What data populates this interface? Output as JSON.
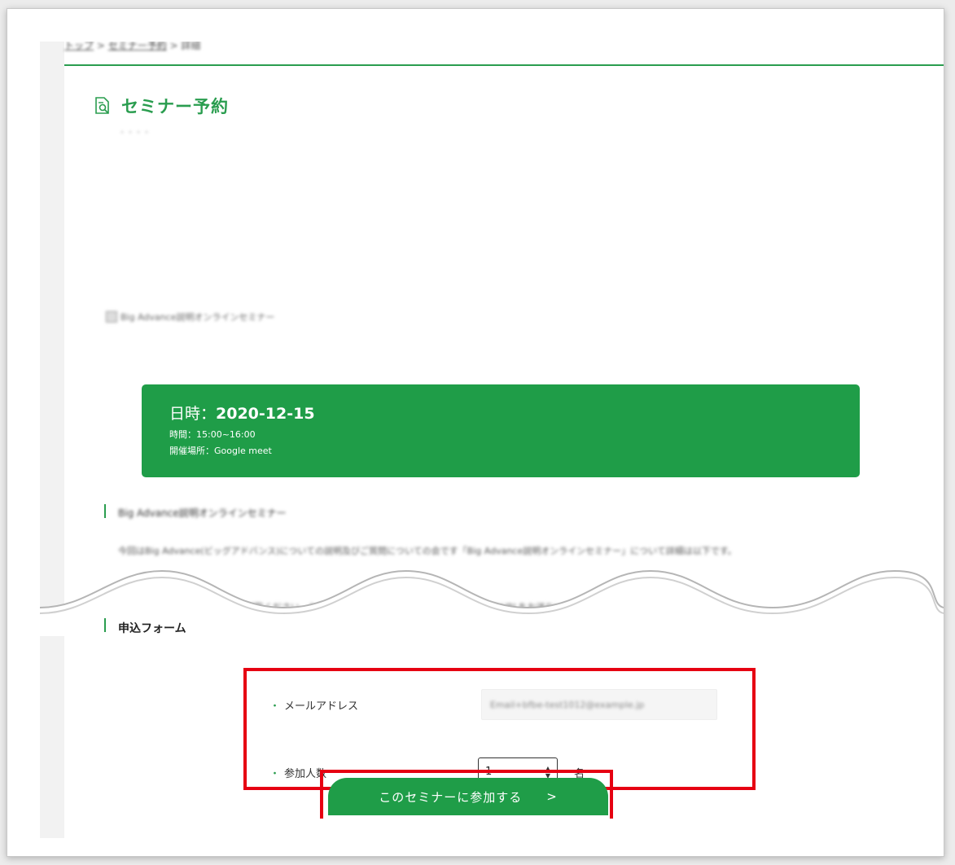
{
  "breadcrumb": {
    "items": [
      "トップ",
      "セミナー予約",
      "詳細"
    ],
    "separator": " > "
  },
  "page": {
    "title": "セミナー予約",
    "subtitle": "・・・・"
  },
  "image_alt": "Big Advance説明オンラインセミナー",
  "event": {
    "date_label": "日時：",
    "date": "2020-12-15",
    "time": "時間：15:00~16:00",
    "venue": "開催場所：Google meet"
  },
  "seminar_section": {
    "heading": "Big Advance説明オンラインセミナー",
    "body": "今回はBig Advance(ビッグアドバンス)についての説明及びご質問についての会です「Big Advance説明オンラインセミナー」について詳細は以下です。",
    "body2": "Big Advanceについてはこちらをご覧ください。お申し込みの方には前日までにGoogle meetのURLをお送りいたします。"
  },
  "form": {
    "heading": "申込フォーム",
    "bullet": "・",
    "email_label": "メールアドレス",
    "email_value": "Email+bfbe-test1012@example.jp",
    "qty_label": "参加人数",
    "qty_value": "1",
    "qty_unit": "名",
    "stepper_up": "▲",
    "stepper_down": "▼"
  },
  "submit": {
    "label": "このセミナーに参加する",
    "arrow": ">"
  },
  "colors": {
    "brand_green": "#1f9d48",
    "highlight_red": "#e60012"
  }
}
